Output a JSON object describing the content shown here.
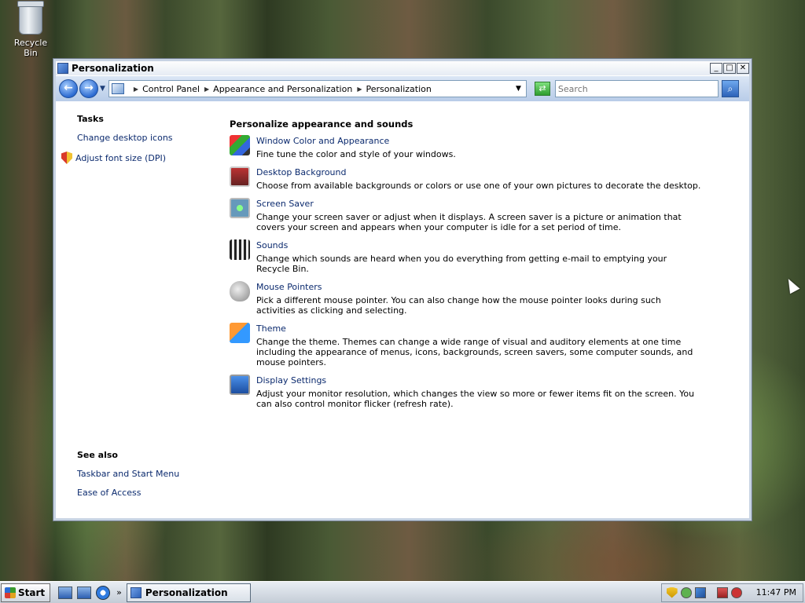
{
  "desktop": {
    "recycle_bin_label": "Recycle Bin"
  },
  "window": {
    "title": "Personalization",
    "controls": {
      "minimize": "_",
      "maximize": "□",
      "close": "✕"
    }
  },
  "navbar": {
    "back_glyph": "←",
    "forward_glyph": "→",
    "breadcrumbs": [
      "Control Panel",
      "Appearance and Personalization",
      "Personalization"
    ],
    "search_placeholder": "Search"
  },
  "tasks": {
    "title": "Tasks",
    "items": [
      "Change desktop icons",
      "Adjust font size (DPI)"
    ]
  },
  "see_also": {
    "title": "See also",
    "items": [
      "Taskbar and Start Menu",
      "Ease of Access"
    ]
  },
  "main": {
    "title": "Personalize appearance and sounds",
    "items": [
      {
        "icon": "window-color-icon",
        "link": "Window Color and Appearance",
        "desc": "Fine tune the color and style of your windows."
      },
      {
        "icon": "desktop-background-icon",
        "link": "Desktop Background",
        "desc": "Choose from available backgrounds or colors or use one of your own pictures to decorate the desktop."
      },
      {
        "icon": "screen-saver-icon",
        "link": "Screen Saver",
        "desc": "Change your screen saver or adjust when it displays. A screen saver is a picture or animation that covers your screen and appears when your computer is idle for a set period of time."
      },
      {
        "icon": "sounds-icon",
        "link": "Sounds",
        "desc": "Change which sounds are heard when you do everything from getting e-mail to emptying your Recycle Bin."
      },
      {
        "icon": "mouse-pointer-icon",
        "link": "Mouse Pointers",
        "desc": "Pick a different mouse pointer. You can also change how the mouse pointer looks during such activities as clicking and selecting."
      },
      {
        "icon": "theme-icon",
        "link": "Theme",
        "desc": "Change the theme. Themes can change a wide range of visual and auditory elements at one time including the appearance of menus, icons, backgrounds, screen savers, some computer sounds, and mouse pointers."
      },
      {
        "icon": "display-settings-icon",
        "link": "Display Settings",
        "desc": "Adjust your monitor resolution, which changes the view so more or fewer items fit on the screen. You can also control monitor flicker (refresh rate)."
      }
    ]
  },
  "taskbar": {
    "start_label": "Start",
    "more_glyph": "»",
    "active_task": "Personalization",
    "clock": "11:47 PM"
  }
}
